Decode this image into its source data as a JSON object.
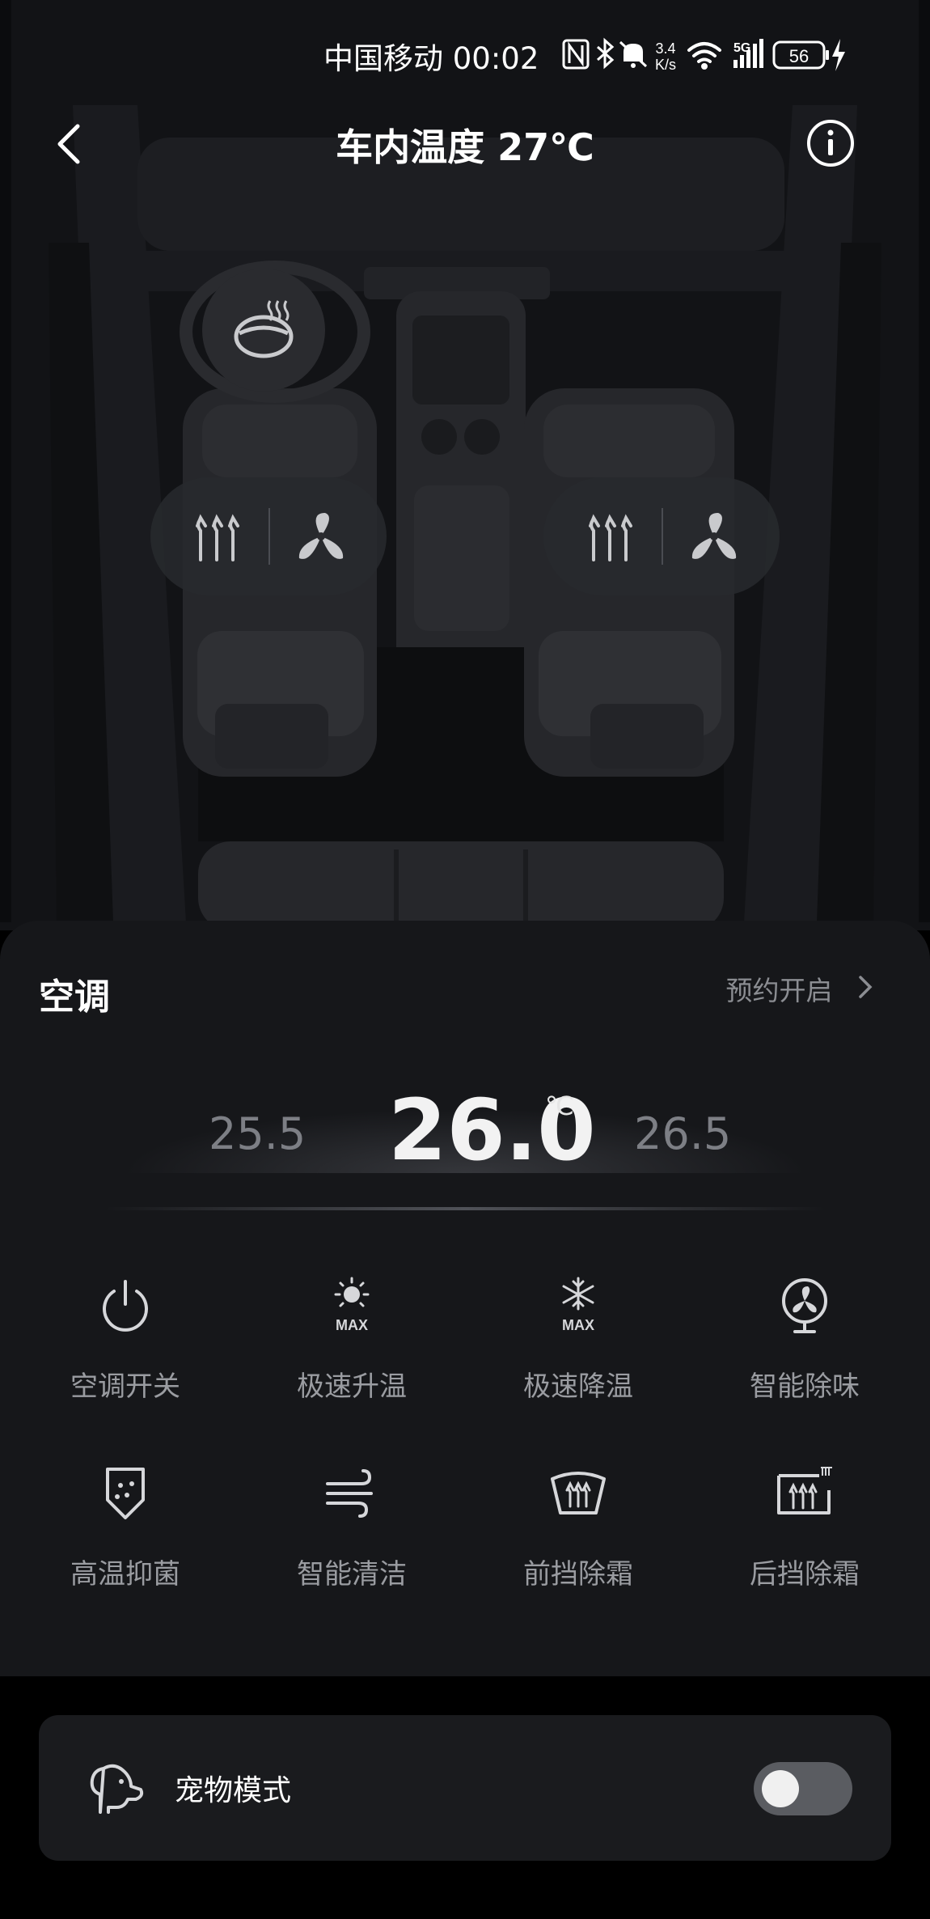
{
  "status_bar": {
    "carrier_time": "中国移动 00:02",
    "net_speed_top": "3.4",
    "net_speed_bottom": "K/s",
    "signal_badge": "5G",
    "battery": "56",
    "icons": [
      "nfc-icon",
      "bluetooth-icon",
      "mute-icon",
      "wifi-icon",
      "signal-icon",
      "battery-icon",
      "charging-icon"
    ]
  },
  "header": {
    "title": "车内温度 27℃",
    "back_icon": "chevron-left-icon",
    "info_icon": "info-icon"
  },
  "seats": {
    "steering_wheel": {
      "icon": "steering-wheel-heat-icon"
    },
    "driver": {
      "heat_icon": "seat-heat-icon",
      "fan_icon": "seat-vent-fan-icon"
    },
    "passenger": {
      "heat_icon": "seat-heat-icon",
      "fan_icon": "seat-vent-fan-icon"
    }
  },
  "ac": {
    "title": "空调",
    "schedule_label": "预约开启",
    "temp_prev": "25.5",
    "temp_current": "26.0",
    "temp_unit": "℃",
    "temp_next": "26.5",
    "functions": [
      {
        "label": "空调开关",
        "icon": "power-icon"
      },
      {
        "label": "极速升温",
        "icon": "sun-max-icon"
      },
      {
        "label": "极速降温",
        "icon": "snowflake-max-icon"
      },
      {
        "label": "智能除味",
        "icon": "fan-deodorize-icon"
      },
      {
        "label": "高温抑菌",
        "icon": "shield-sterilize-icon"
      },
      {
        "label": "智能清洁",
        "icon": "wind-clean-icon"
      },
      {
        "label": "前挡除霜",
        "icon": "front-defrost-icon"
      },
      {
        "label": "后挡除霜",
        "icon": "rear-defrost-icon"
      }
    ],
    "max_badge": "MAX"
  },
  "pet_mode": {
    "label": "宠物模式",
    "icon": "dog-icon",
    "enabled": false
  },
  "colors": {
    "background": "#000000",
    "panel": "#16171a",
    "card": "#1a1b1e",
    "muted_text": "#9a9ca1",
    "toggle_off": "#5a5c61"
  }
}
